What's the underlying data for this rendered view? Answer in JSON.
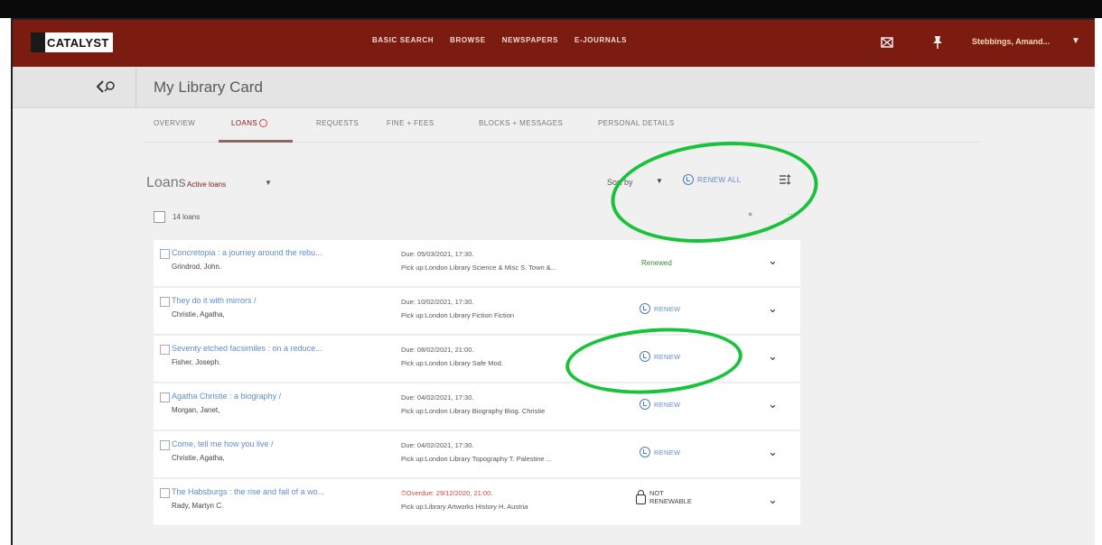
{
  "app": {
    "logo_text": "CATALYST",
    "nav": [
      "BASIC SEARCH",
      "BROWSE",
      "NEWSPAPERS",
      "E-JOURNALS"
    ],
    "user": "Stebbings, Amand...",
    "colors": {
      "header": "#7c1c10",
      "accent_link": "#5d8ccb",
      "renewed_green": "#3c8a3c",
      "overdue_red": "#d9473a",
      "annotation_green": "#19c23b"
    }
  },
  "icons": {
    "collection": "collection-icon",
    "pin": "pin-icon",
    "back": "back-search-icon"
  },
  "page": {
    "title": "My Library Card"
  },
  "tabs": [
    {
      "label": "OVERVIEW"
    },
    {
      "label": "LOANS"
    },
    {
      "label": "REQUESTS"
    },
    {
      "label": "FINE + FEES"
    },
    {
      "label": "BLOCKS + MESSAGES"
    },
    {
      "label": "PERSONAL DETAILS"
    }
  ],
  "loans": {
    "title": "Loans",
    "filter": "Active loans",
    "sort_label": "Sort by",
    "renew_all": "RENEW ALL",
    "count": "14 loans",
    "items": [
      {
        "title": "Concretopia : a journey around the rebu...",
        "author": "Grindrod, John.",
        "due": "Due: 05/03/2021, 17:30.",
        "pickup": "Pick up:London Library Science & Misc S. Town &...",
        "status": "Renewed",
        "action": ""
      },
      {
        "title": "They do it with mirrors /",
        "author": "Christie, Agatha,",
        "due": "Due: 10/02/2021, 17:30.",
        "pickup": "Pick up:London Library Fiction Fiction",
        "status": "",
        "action": "RENEW"
      },
      {
        "title": "Seventy etched facsimiles : on a reduce...",
        "author": "Fisher, Joseph.",
        "due": "Due: 08/02/2021, 21:00.",
        "pickup": "Pick up:London Library Safe Mod.",
        "status": "",
        "action": "RENEW"
      },
      {
        "title": "Agatha Christie : a biography /",
        "author": "Morgan, Janet,",
        "due": "Due: 04/02/2021, 17:30.",
        "pickup": "Pick up:London Library Biography Biog. Christie",
        "status": "",
        "action": "RENEW"
      },
      {
        "title": "Come, tell me how you live /",
        "author": "Christie, Agatha,",
        "due": "Due: 04/02/2021, 17:30.",
        "pickup": "Pick up:London Library Topography T. Palestine ...",
        "status": "",
        "action": "RENEW"
      },
      {
        "title": "The Habsburgs : the rise and fall of a wo...",
        "author": "Rady, Martyn C.",
        "due": "Overdue: 29/12/2020, 21:00.",
        "pickup": "Pick up:Library Artworks History H. Austria",
        "status": "",
        "action": "NOT RENEWABLE"
      }
    ]
  }
}
